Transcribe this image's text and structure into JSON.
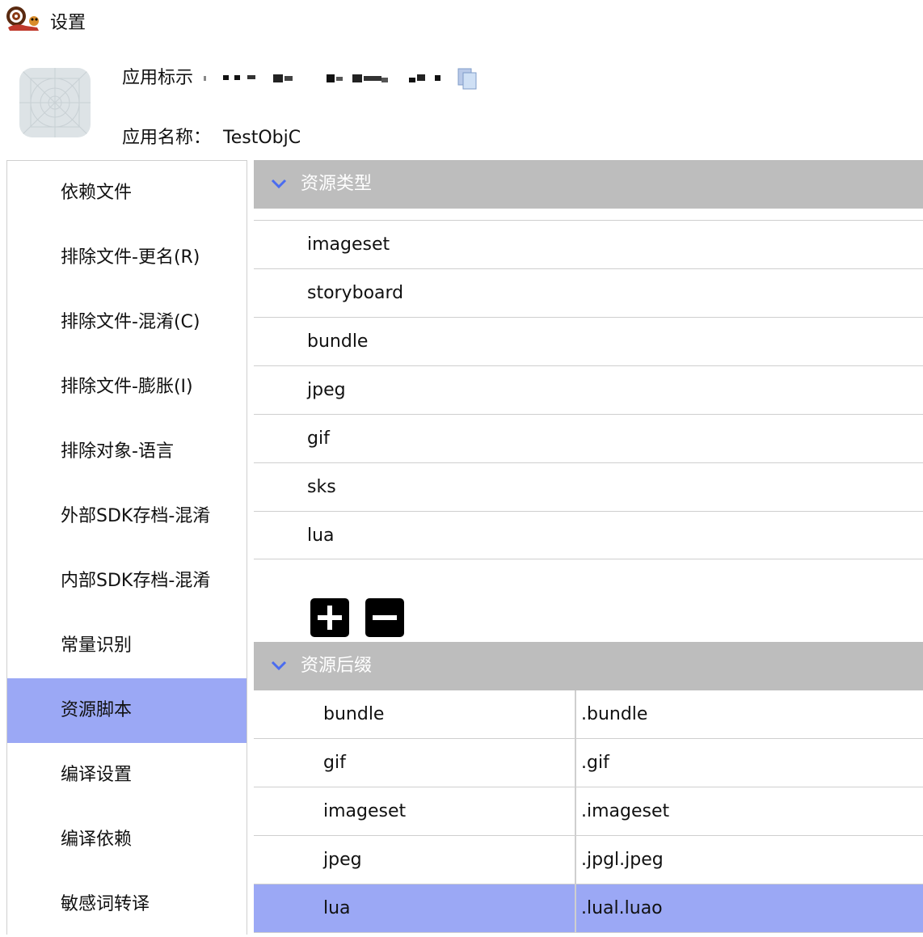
{
  "window": {
    "title": "设置"
  },
  "app": {
    "id_label": "应用标示",
    "name_label": "应用名称：",
    "name_value": "TestObjC"
  },
  "sidebar": {
    "items": [
      {
        "label": "依赖文件"
      },
      {
        "label": "排除文件-更名(R)"
      },
      {
        "label": "排除文件-混淆(C)"
      },
      {
        "label": "排除文件-膨胀(I)"
      },
      {
        "label": "排除对象-语言"
      },
      {
        "label": "外部SDK存档-混淆"
      },
      {
        "label": "内部SDK存档-混淆"
      },
      {
        "label": "常量识别"
      },
      {
        "label": "资源脚本"
      },
      {
        "label": "编译设置"
      },
      {
        "label": "编译依赖"
      },
      {
        "label": "敏感词转译"
      }
    ],
    "active_index": 8
  },
  "resource_types": {
    "title": "资源类型",
    "items": [
      "imageset",
      "storyboard",
      "bundle",
      "jpeg",
      "gif",
      "sks",
      "lua"
    ],
    "add_icon": "plus-icon",
    "remove_icon": "minus-icon"
  },
  "resource_suffixes": {
    "title": "资源后缀",
    "rows": [
      {
        "type": "bundle",
        "suffix": ".bundle"
      },
      {
        "type": "gif",
        "suffix": ".gif"
      },
      {
        "type": "imageset",
        "suffix": ".imageset"
      },
      {
        "type": "jpeg",
        "suffix": ".jpgl.jpeg"
      },
      {
        "type": "lua",
        "suffix": ".lual.luao"
      }
    ],
    "selected_index": 4
  },
  "colors": {
    "selection": "#9ba8f5",
    "section_header": "#bdbdbd",
    "chevron": "#4a6cf0"
  }
}
